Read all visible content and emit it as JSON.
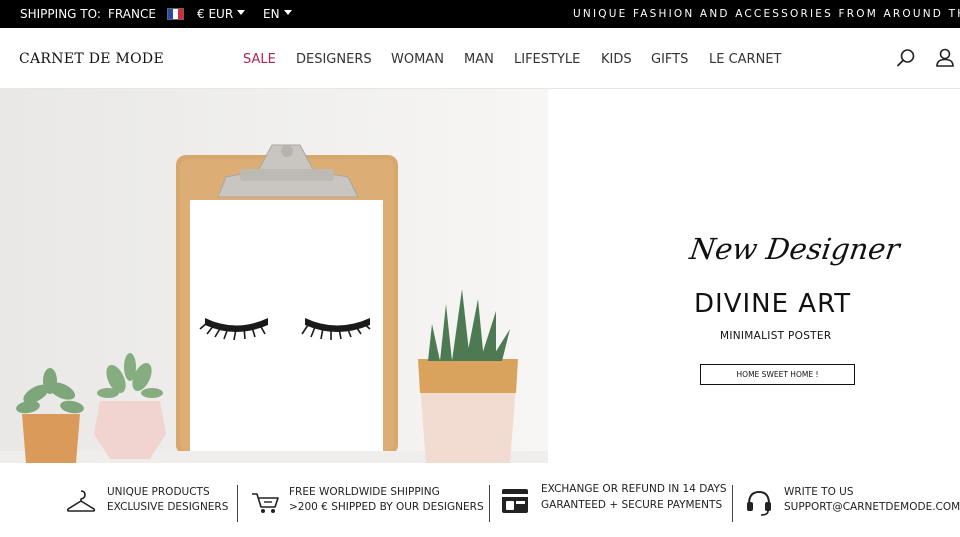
{
  "topbar": {
    "shipping_label": "SHIPPING TO:",
    "shipping_country": "FRANCE",
    "flag_icon": "france-flag-icon",
    "currency": "€ EUR",
    "language": "EN",
    "tagline": "UNIQUE FASHION AND ACCESSORIES FROM AROUND THE W"
  },
  "header": {
    "logo": "CARNET DE MODE",
    "nav": [
      "SALE",
      "DESIGNERS",
      "WOMAN",
      "MAN",
      "LIFESTYLE",
      "KIDS",
      "GIFTS",
      "LE CARNET"
    ],
    "sale_color": "#b0264c",
    "icons": [
      "search-icon",
      "user-icon"
    ]
  },
  "hero": {
    "script_title": "New Designer",
    "brand": "DIVINE ART",
    "subtitle": "MINIMALIST POSTER",
    "cta": "HOME SWEET HOME !"
  },
  "features": [
    {
      "icon": "hanger-icon",
      "line1": "UNIQUE PRODUCTS",
      "line2": "EXCLUSIVE DESIGNERS"
    },
    {
      "icon": "cart-icon",
      "line1": "FREE WORLDWIDE SHIPPING",
      "line2": ">200 € SHIPPED BY OUR DESIGNERS"
    },
    {
      "icon": "payment-icon",
      "line1": "EXCHANGE OR REFUND IN 14 DAYS",
      "line2": "GARANTEED + SECURE PAYMENTS"
    },
    {
      "icon": "headset-icon",
      "line1": "WRITE TO US",
      "line2": "SUPPORT@CARNETDEMODE.COM"
    }
  ]
}
